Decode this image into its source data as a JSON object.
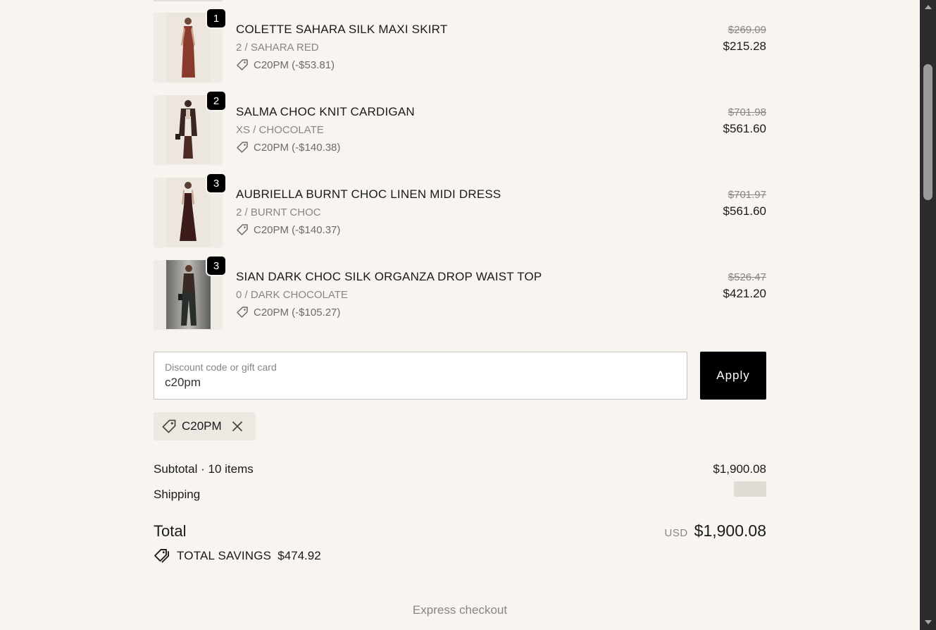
{
  "items": [
    {
      "quantity": "1",
      "name": "COLETTE SAHARA SILK MAXI SKIRT",
      "variant": "2 / SAHARA RED",
      "discount": "C20PM (-$53.81)",
      "original_price": "$269.09",
      "final_price": "$215.28",
      "garment_color": "#8a3a2c"
    },
    {
      "quantity": "2",
      "name": "SALMA CHOC KNIT CARDIGAN",
      "variant": "XS / CHOCOLATE",
      "discount": "C20PM (-$140.38)",
      "original_price": "$701.98",
      "final_price": "$561.60",
      "garment_color": "#3a2620"
    },
    {
      "quantity": "3",
      "name": "AUBRIELLA BURNT CHOC LINEN MIDI DRESS",
      "variant": "2 / BURNT CHOC",
      "discount": "C20PM (-$140.37)",
      "original_price": "$701.97",
      "final_price": "$561.60",
      "garment_color": "#3b1c1a"
    },
    {
      "quantity": "3",
      "name": "SIAN DARK CHOC SILK ORGANZA DROP WAIST TOP",
      "variant": "0 / DARK CHOCOLATE",
      "discount": "C20PM (-$105.27)",
      "original_price": "$526.47",
      "final_price": "$421.20",
      "garment_color": "#2a2422"
    }
  ],
  "discount_form": {
    "label": "Discount code or gift card",
    "value": "c20pm",
    "apply_label": "Apply"
  },
  "applied_code": "C20PM",
  "summary": {
    "subtotal_label": "Subtotal · 10 items",
    "subtotal_value": "$1,900.08",
    "shipping_label": "Shipping",
    "total_label": "Total",
    "currency": "USD",
    "total_value": "$1,900.08",
    "savings_label": "TOTAL SAVINGS",
    "savings_value": "$474.92"
  },
  "express_checkout_label": "Express checkout",
  "colors": {
    "background": "#f8f5f1",
    "accent": "#000000",
    "muted_text": "#8a8580"
  }
}
